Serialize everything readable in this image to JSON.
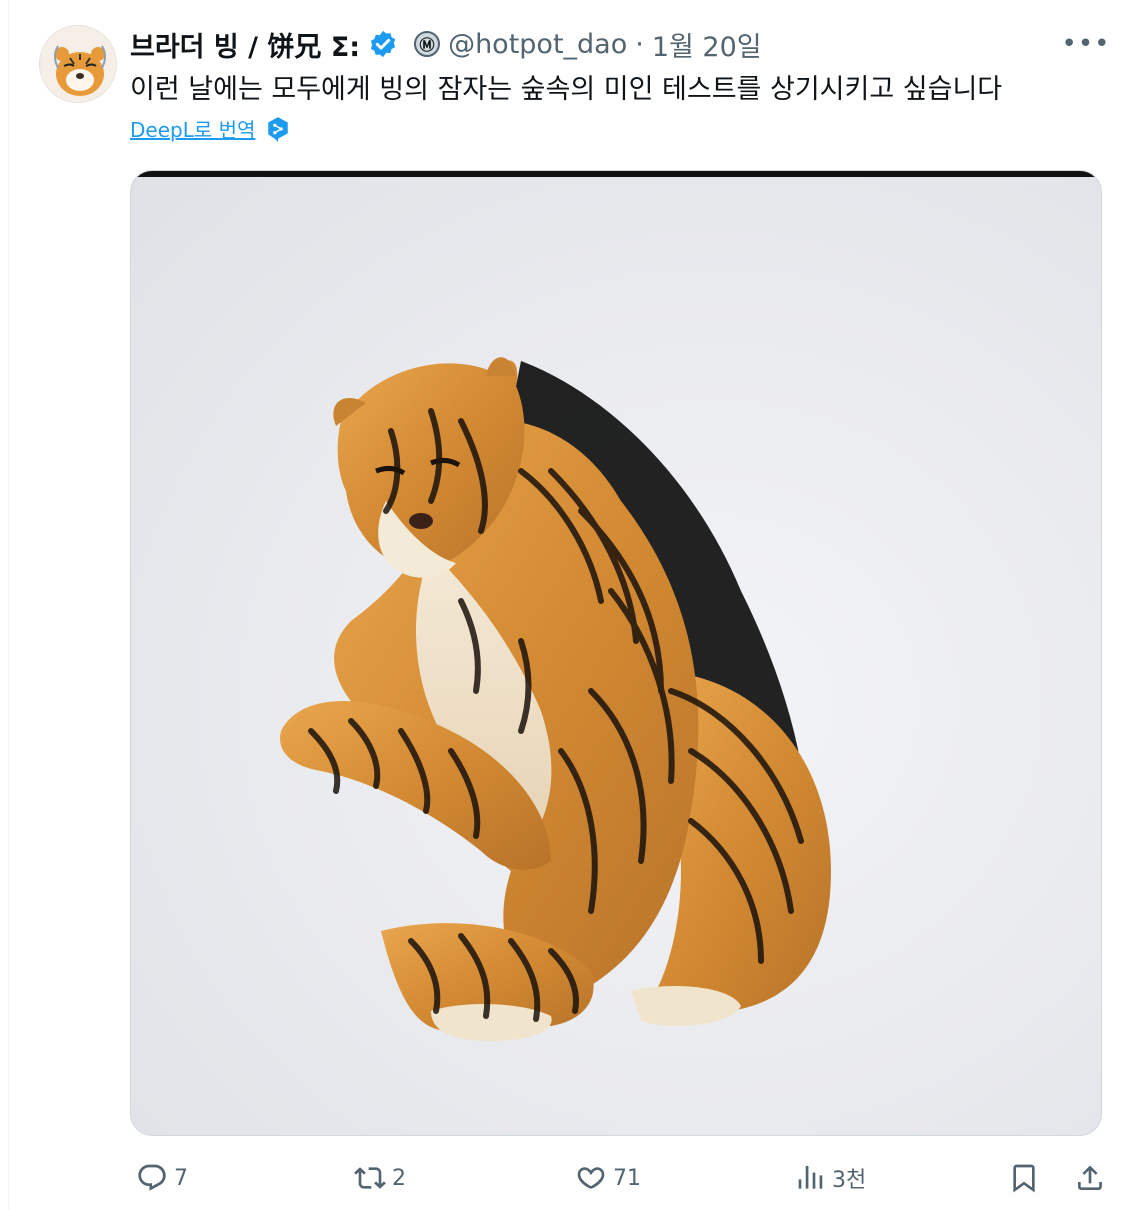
{
  "tweet": {
    "display_name": "브라더 빙 / 饼兄 Σ:",
    "affiliate_badge": "Ⓜ",
    "handle": "@hotpot_dao",
    "separator": "·",
    "date": "1월 20일",
    "more_label": "•••",
    "text": "이런 날에는 모두에게 빙의 잠자는 숲속의 미인 테스트를 상기시키고 싶습니다",
    "translate_label": "DeepL로 번역"
  },
  "actions": {
    "replies": "7",
    "reposts": "2",
    "likes": "71",
    "views": "3천"
  },
  "colors": {
    "accent": "#1d9bf0",
    "muted": "#536471",
    "text": "#0f1419",
    "verified": "#1d9bf0",
    "deepl": "#1d9bf0"
  },
  "icons": {
    "verified": "verified-badge-icon",
    "affiliate": "affiliate-badge-icon",
    "more": "more-icon",
    "translate": "deepl-icon",
    "reply": "reply-icon",
    "repost": "repost-icon",
    "like": "like-icon",
    "views": "views-icon",
    "bookmark": "bookmark-icon",
    "share": "share-icon"
  },
  "media": {
    "subject": "sitting-tiger"
  }
}
